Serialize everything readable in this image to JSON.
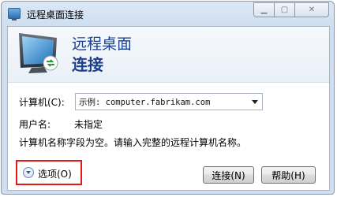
{
  "window": {
    "title": "远程桌面连接",
    "controls": {
      "minimize": "▁",
      "maximize": "▢",
      "close": "✕"
    }
  },
  "banner": {
    "line1": "远程桌面",
    "line2": "连接"
  },
  "form": {
    "computer_label": "计算机(C):",
    "computer_value": "示例: computer.fabrikam.com",
    "username_label": "用户名:",
    "username_value": "未指定",
    "message": "计算机名称字段为空。请输入完整的远程计算机名称。"
  },
  "footer": {
    "options_label": "选项(O)",
    "connect_label": "连接(N)",
    "help_label": "帮助(H)"
  },
  "colors": {
    "banner_text": "#1c3f8c",
    "highlight_box": "#e21a1a"
  },
  "icons": {
    "app": "remote-desktop-icon",
    "banner": "monitor-connection-icon",
    "options": "expand-circle-icon",
    "combo": "chevron-down-icon"
  }
}
